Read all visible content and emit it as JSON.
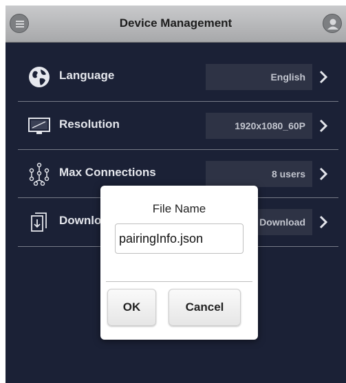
{
  "header": {
    "title": "Device Management",
    "left_icon": "menu-icon",
    "right_icon": "user-icon"
  },
  "settings": [
    {
      "label": "Language",
      "value": "English",
      "icon": "globe-icon"
    },
    {
      "label": "Resolution",
      "value": "1920x1080_60P",
      "icon": "monitor-icon"
    },
    {
      "label": "Max Connections",
      "value": "8 users",
      "icon": "network-icon"
    },
    {
      "label": "Download",
      "value": "Download",
      "icon": "download-file-icon"
    }
  ],
  "dialog": {
    "title": "File Name",
    "input_value": "pairingInfo.json",
    "ok_label": "OK",
    "cancel_label": "Cancel"
  },
  "colors": {
    "background": "#1b2136",
    "header": "#b7b8ba",
    "value_box": "#2e3345",
    "label_text": "#e4e6ec"
  }
}
